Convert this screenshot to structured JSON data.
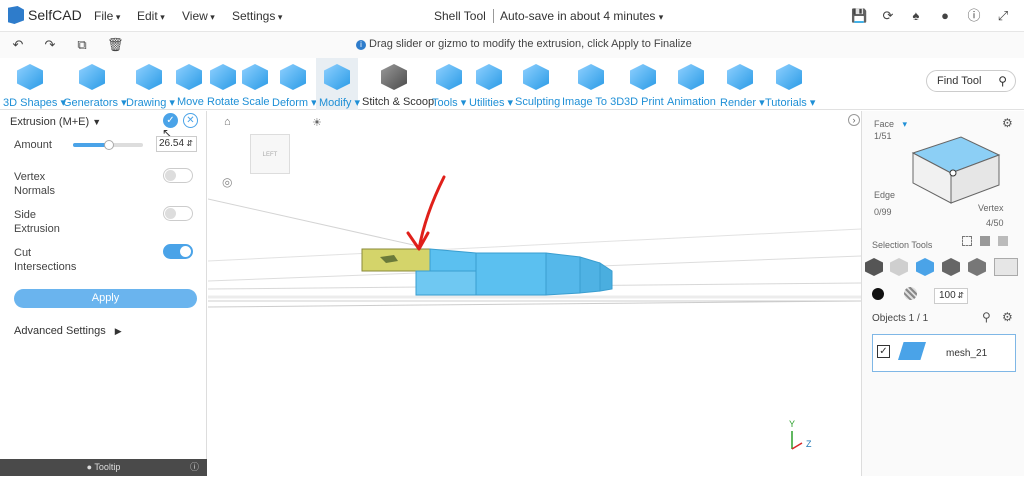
{
  "app": {
    "name": "SelfCAD",
    "doc_title": "Shell Tool",
    "autosave": "Auto-save in about 4 minutes"
  },
  "menus": [
    "File",
    "Edit",
    "View",
    "Settings"
  ],
  "hint": "Drag slider or gizmo to modify the extrusion, click Apply to Finalize",
  "tools": [
    "3D Shapes",
    "Generators",
    "Drawing",
    "Move",
    "Rotate",
    "Scale",
    "Deform",
    "Modify",
    "Stitch & Scoop",
    "Tools",
    "Utilities",
    "Sculpting",
    "Image To 3D",
    "3D Print",
    "Animation",
    "Render",
    "Tutorials"
  ],
  "find_tool": "Find Tool",
  "panel": {
    "title": "Extrusion (M+E)",
    "amount_label": "Amount",
    "amount_value": "26.54",
    "amount_fraction": 0.52,
    "vertex_normals": [
      "Vertex",
      "Normals"
    ],
    "side_extrusion": [
      "Side",
      "Extrusion"
    ],
    "cut_intersections": [
      "Cut",
      "Intersections"
    ],
    "toggles": {
      "vertex_normals": false,
      "side_extrusion": false,
      "cut_intersections": true
    },
    "apply": "Apply",
    "advanced": "Advanced Settings",
    "tooltip": "Tooltip"
  },
  "right": {
    "face_label": "Face",
    "face_count": "1/51",
    "edge_label": "Edge",
    "edge_count": "0/99",
    "vertex_label": "Vertex",
    "vertex_count": "4/50",
    "selection_tools": "Selection Tools",
    "opacity": "100",
    "objects_title": "Objects 1 / 1",
    "object_name": "mesh_21"
  },
  "viewcube_label": "LEFT",
  "axes": {
    "y": "Y",
    "z": "Z"
  },
  "colors": {
    "accent": "#1e8fd6",
    "mesh": "#5bc0f0",
    "selected_face": "#d4d46a",
    "annotation": "#e0201a"
  }
}
